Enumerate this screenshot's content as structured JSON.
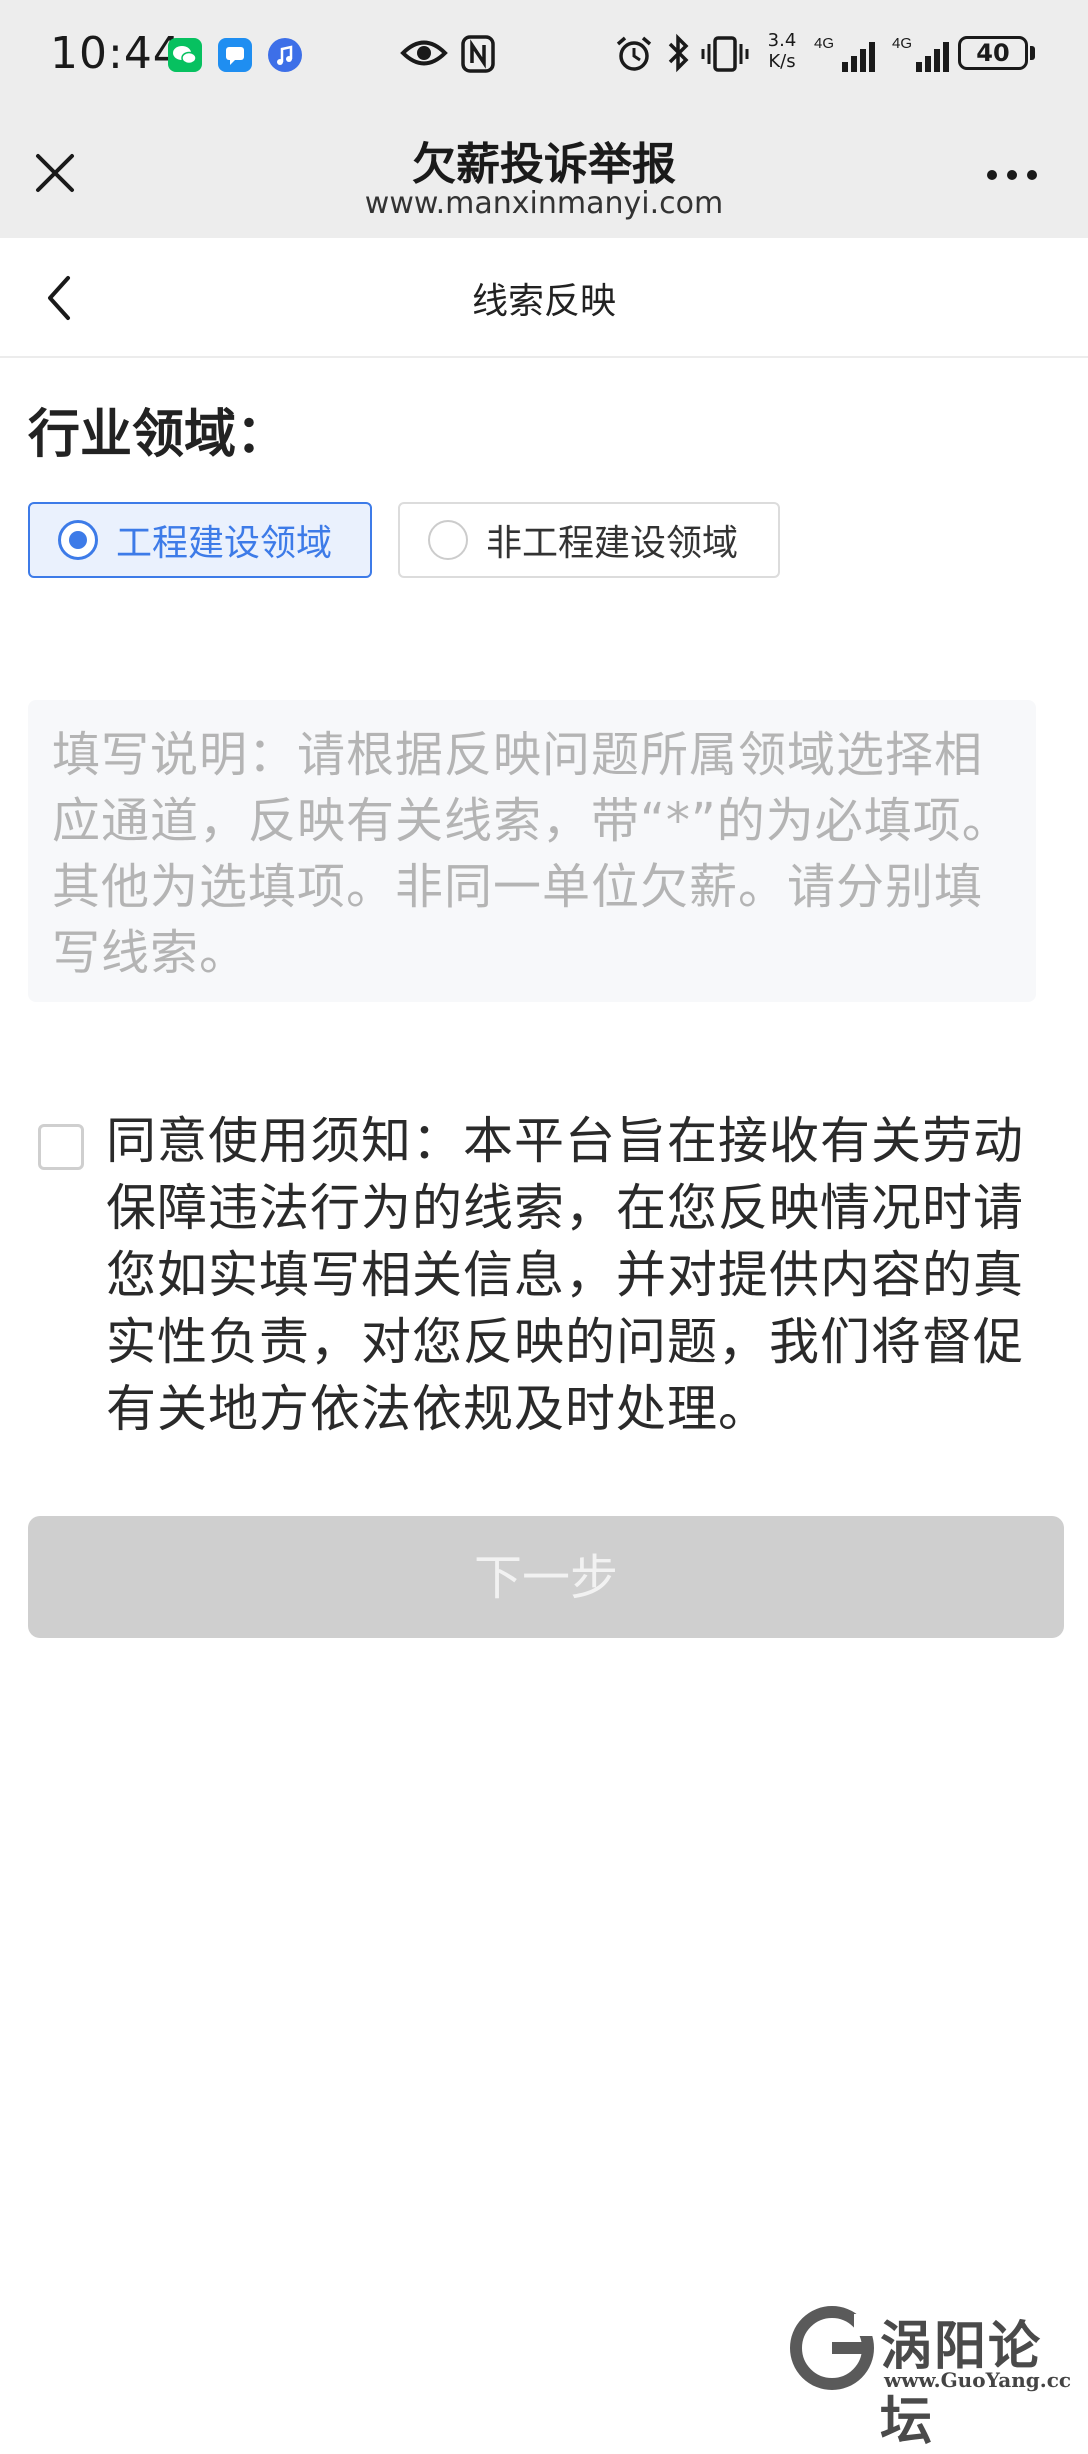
{
  "status_bar": {
    "time": "10:44",
    "network_speed_value": "3.4",
    "network_speed_unit": "K/s",
    "signal1_label": "4G",
    "signal2_label": "4G",
    "battery": "40",
    "battery_level": 0.4
  },
  "browser": {
    "title": "欠薪投诉举报",
    "url": "www.manxinmanyi.com"
  },
  "page": {
    "title": "线索反映"
  },
  "industry": {
    "label": "行业领域：",
    "options": [
      {
        "label": "工程建设领域",
        "selected": true
      },
      {
        "label": "非工程建设领域",
        "selected": false
      }
    ]
  },
  "instructions": {
    "text": "填写说明：请根据反映问题所属领域选择相应通道，反映有关线索，带“*”的为必填项。其他为选填项。非同一单位欠薪。请分别填写线索。"
  },
  "agreement": {
    "checked": false,
    "text": "同意使用须知：本平台旨在接收有关劳动保障违法行为的线索，在您反映情况时请您如实填写相关信息，并对提供内容的真实性负责，对您反映的问题，我们将督促有关地方依法依规及时处理。"
  },
  "next_button": {
    "label": "下一步",
    "enabled": false
  },
  "watermark": {
    "name": "涡阳论坛",
    "domain": "www.GuoYang.cc"
  },
  "colors": {
    "accent": "#3d7be8",
    "header_bg": "#ededed",
    "button_disabled": "#cfcfcf",
    "placeholder_text": "#b4b4b4"
  }
}
